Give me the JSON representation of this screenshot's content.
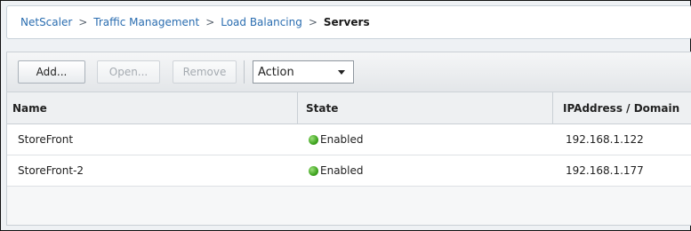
{
  "breadcrumb": {
    "items": [
      "NetScaler",
      "Traffic Management",
      "Load Balancing"
    ],
    "separator": ">",
    "current": "Servers"
  },
  "toolbar": {
    "add_label": "Add...",
    "open_label": "Open...",
    "remove_label": "Remove",
    "action_select": "Action"
  },
  "table": {
    "columns": [
      "Name",
      "State",
      "IPAddress / Domain"
    ],
    "rows": [
      {
        "name": "StoreFront",
        "state": "Enabled",
        "ip": "192.168.1.122"
      },
      {
        "name": "StoreFront-2",
        "state": "Enabled",
        "ip": "192.168.1.177"
      }
    ]
  },
  "colors": {
    "link": "#2a6db0",
    "enabled_status": "#3fa420"
  }
}
